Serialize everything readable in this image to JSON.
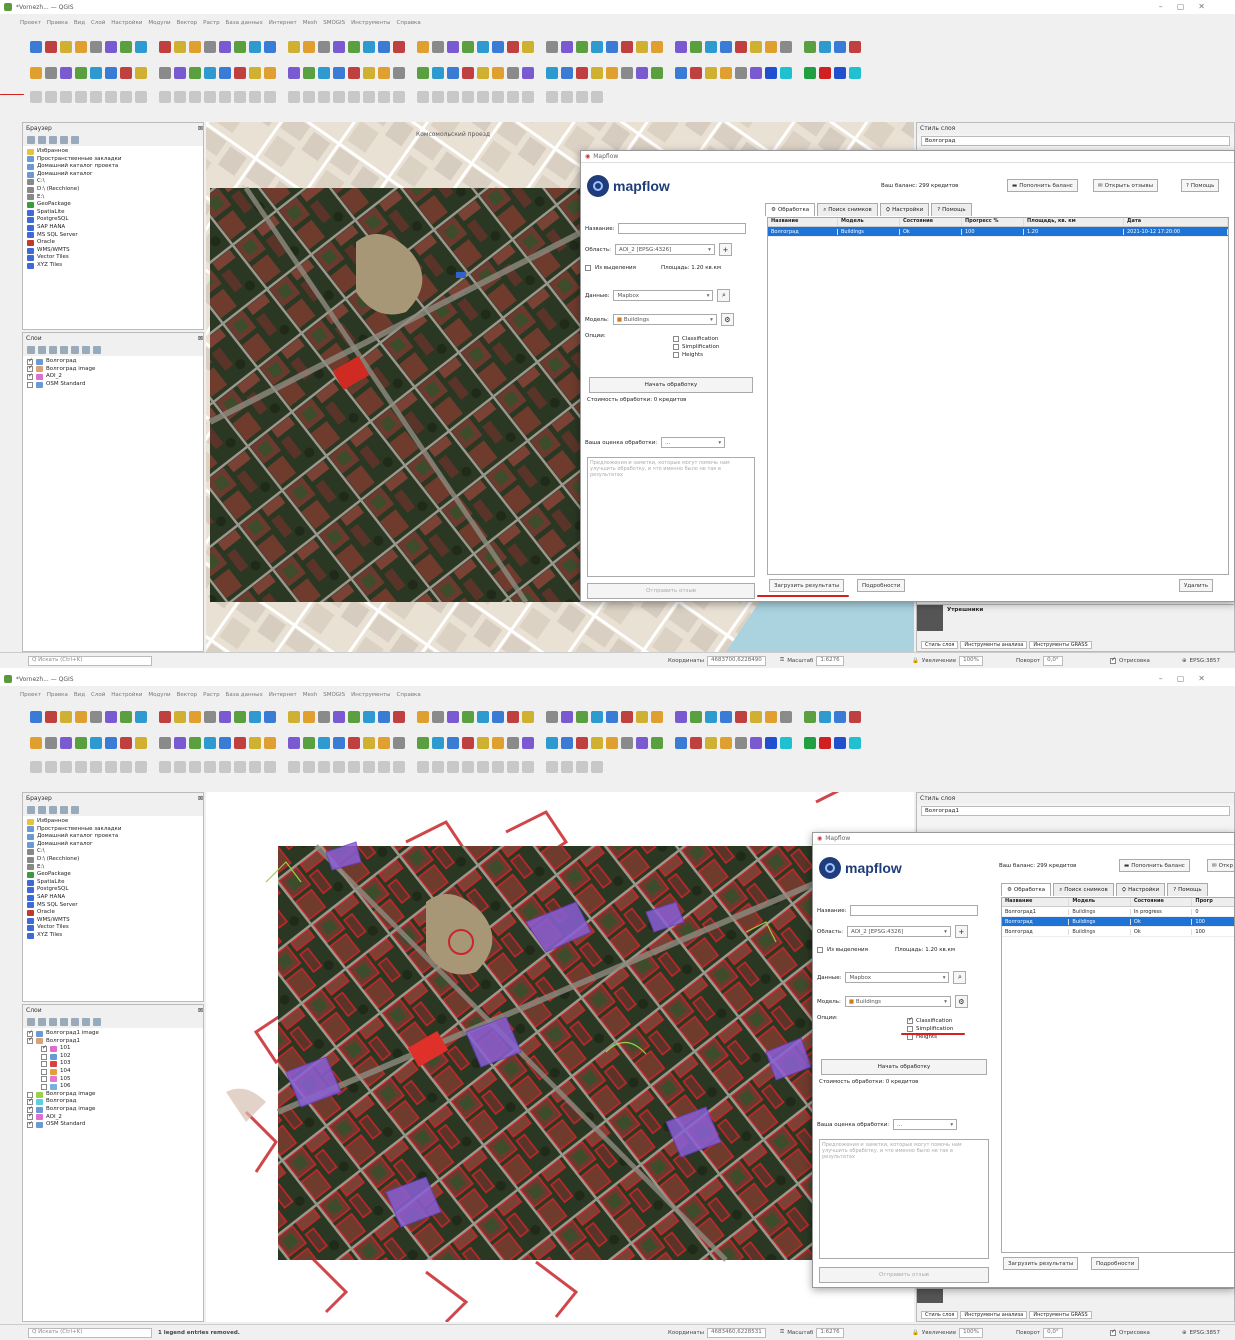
{
  "screen1": {
    "window_title": "*Vornezh... — QGIS",
    "menu": [
      "Проект",
      "Правка",
      "Вид",
      "Слой",
      "Настройки",
      "Модули",
      "Вектор",
      "Растр",
      "База данных",
      "Интернет",
      "Mesh",
      "SMOGIS",
      "Инструменты",
      "Справка"
    ],
    "browser": {
      "title": "Браузер",
      "items": [
        "Избранное",
        "Пространственные закладки",
        "Домашний каталог проекта",
        "Домашний каталог",
        "C:\\",
        "D:\\ (Recchione)",
        "E:\\",
        "GeoPackage",
        "SpatiaLite",
        "PostgreSQL",
        "SAP HANA",
        "MS SQL Server",
        "Oracle",
        "WMS/WMTS",
        "Vector Tiles",
        "XYZ Tiles"
      ]
    },
    "layers": {
      "title": "Слои",
      "items": [
        "Волгоград",
        "Волгоград image",
        "AOI_2",
        "OSM Standard"
      ]
    },
    "right_panel": {
      "title": "Стиль слоя",
      "layer": "Волгоград"
    },
    "map_labels": [
      "Комсомольский проезд"
    ],
    "bottom_dock": {
      "title": "Утрешники",
      "tabs": [
        "Стиль слоя",
        "Инструменты анализа",
        "Инструменты GRASS"
      ]
    },
    "status": {
      "search_placeholder": "Q  Искать (Ctrl+K)",
      "coord_label": "Координаты",
      "coord_value": "4683700,6228490",
      "scale_label": "Масштаб",
      "scale_value": "1:6276",
      "magnifier_label": "Увеличение",
      "magnifier_value": "100%",
      "rotation_label": "Поворот",
      "rotation_value": "0,0°",
      "render_label": "Отрисовка",
      "crs": "EPSG:3857"
    },
    "dialog": {
      "title": "Mapflow",
      "balance": "Ваш баланс: 299 кредитов",
      "btn_top": [
        "Пополнить баланс",
        "Открыть отзывы",
        "Помощь"
      ],
      "tabs": [
        "Обработка",
        "Поиск снимков",
        "Настройки",
        "Помощь"
      ],
      "form": {
        "name_label": "Название:",
        "area_label": "Область:",
        "area_value": "AOI_2 [EPSG:4326]",
        "use_selection": "Из выделения",
        "area_size": "Площадь: 1.20 кв.км",
        "data_label": "Данные:",
        "data_value": "Mapbox",
        "model_label": "Модель:",
        "model_value": "Buildings",
        "options_label": "Опции:",
        "options": [
          "Classification",
          "Simplification",
          "Heights"
        ],
        "start_btn": "Начать обработку",
        "cost_text": "Стоимость обработки: 0 кредитов",
        "review_label": "Ваша оценка обработки:",
        "review_value": "...",
        "review_placeholder": "Предложения и заметки, которые могут помочь нам улучшить обработку, и что именно было не так в результатах",
        "send_btn": "Отправить отзыв"
      },
      "table": {
        "columns": [
          "Название",
          "Модель",
          "Состояние",
          "Прогресс %",
          "Площадь, кв. км",
          "Дата"
        ],
        "rows": [
          [
            "Волгоград",
            "Buildings",
            "Ok",
            "100",
            "1.20",
            "2021-10-12 17:20:00"
          ]
        ]
      },
      "bottom_btns": [
        "Загрузить результаты",
        "Подробности"
      ],
      "close_btn": "Удалить"
    }
  },
  "screen2": {
    "window_title": "*Vornezh... — QGIS",
    "menu": [
      "Проект",
      "Правка",
      "Вид",
      "Слой",
      "Настройки",
      "Модули",
      "Вектор",
      "Растр",
      "База данных",
      "Интернет",
      "Mesh",
      "SMOGIS",
      "Инструменты",
      "Справка"
    ],
    "browser": {
      "title": "Браузер",
      "items": [
        "Избранное",
        "Пространственные закладки",
        "Домашний каталог проекта",
        "Домашний каталог",
        "C:\\",
        "D:\\ (Recchione)",
        "E:\\",
        "GeoPackage",
        "SpatiaLite",
        "PostgreSQL",
        "SAP HANA",
        "MS SQL Server",
        "Oracle",
        "WMS/WMTS",
        "Vector Tiles",
        "XYZ Tiles"
      ]
    },
    "layers": {
      "title": "Слои",
      "items": [
        "Волгоград1 image",
        "Волгоград1",
        "101",
        "102",
        "103",
        "104",
        "105",
        "106",
        "Волгоград image",
        "Волгоград",
        "Волгоград image",
        "AOI_2",
        "OSM Standard"
      ]
    },
    "right_panel": {
      "title": "Стиль слоя",
      "layer": "Волгоград1"
    },
    "bottom_dock": {
      "tabs": [
        "Стиль слоя",
        "Инструменты анализа",
        "Инструменты GRASS"
      ]
    },
    "status": {
      "search_placeholder": "Q  Искать (Ctrl+K)",
      "message": "1 legend entries removed.",
      "coord_label": "Координаты",
      "coord_value": "4683460,6228531",
      "scale_label": "Масштаб",
      "scale_value": "1:6276",
      "magnifier_label": "Увеличение",
      "magnifier_value": "100%",
      "rotation_label": "Поворот",
      "rotation_value": "0,0°",
      "render_label": "Отрисовка",
      "crs": "EPSG:3857"
    },
    "dialog": {
      "title": "Mapflow",
      "balance": "Ваш баланс: 299 кредитов",
      "btn_top": [
        "Пополнить баланс",
        "Откр"
      ],
      "tabs": [
        "Обработка",
        "Поиск снимков",
        "Настройки",
        "Помощь"
      ],
      "form": {
        "name_label": "Название:",
        "area_label": "Область:",
        "area_value": "AOI_2 [EPSG:4326]",
        "use_selection": "Из выделения",
        "area_size": "Площадь: 1.20 кв.км",
        "data_label": "Данные:",
        "data_value": "Mapbox",
        "model_label": "Модель:",
        "model_value": "Buildings",
        "options_label": "Опции:",
        "options": [
          "Classification",
          "Simplification",
          "Heights"
        ],
        "start_btn": "Начать обработку",
        "cost_text": "Стоимость обработки: 0 кредитов",
        "review_label": "Ваша оценка обработки:",
        "review_value": "...",
        "review_placeholder": "Предложения и заметки, которые могут помочь нам улучшить обработку, и что именно было не так в результатах",
        "send_btn": "Отправить отзыв"
      },
      "table": {
        "columns": [
          "Название",
          "Модель",
          "Состояние",
          "Прогр"
        ],
        "rows": [
          [
            "Волгоград1",
            "Buildings",
            "In progress",
            "0"
          ],
          [
            "Волгоград",
            "Buildings",
            "Ok",
            "100"
          ],
          [
            "Волгоград",
            "Buildings",
            "Ok",
            "100"
          ]
        ]
      },
      "bottom_btns": [
        "Загрузить результаты",
        "Подробности"
      ]
    }
  },
  "colors": {
    "accent": "#1e74d6",
    "annotation": "#d32020",
    "building_outline": "#c8262a",
    "classified_fill": "#8a5fd6"
  }
}
